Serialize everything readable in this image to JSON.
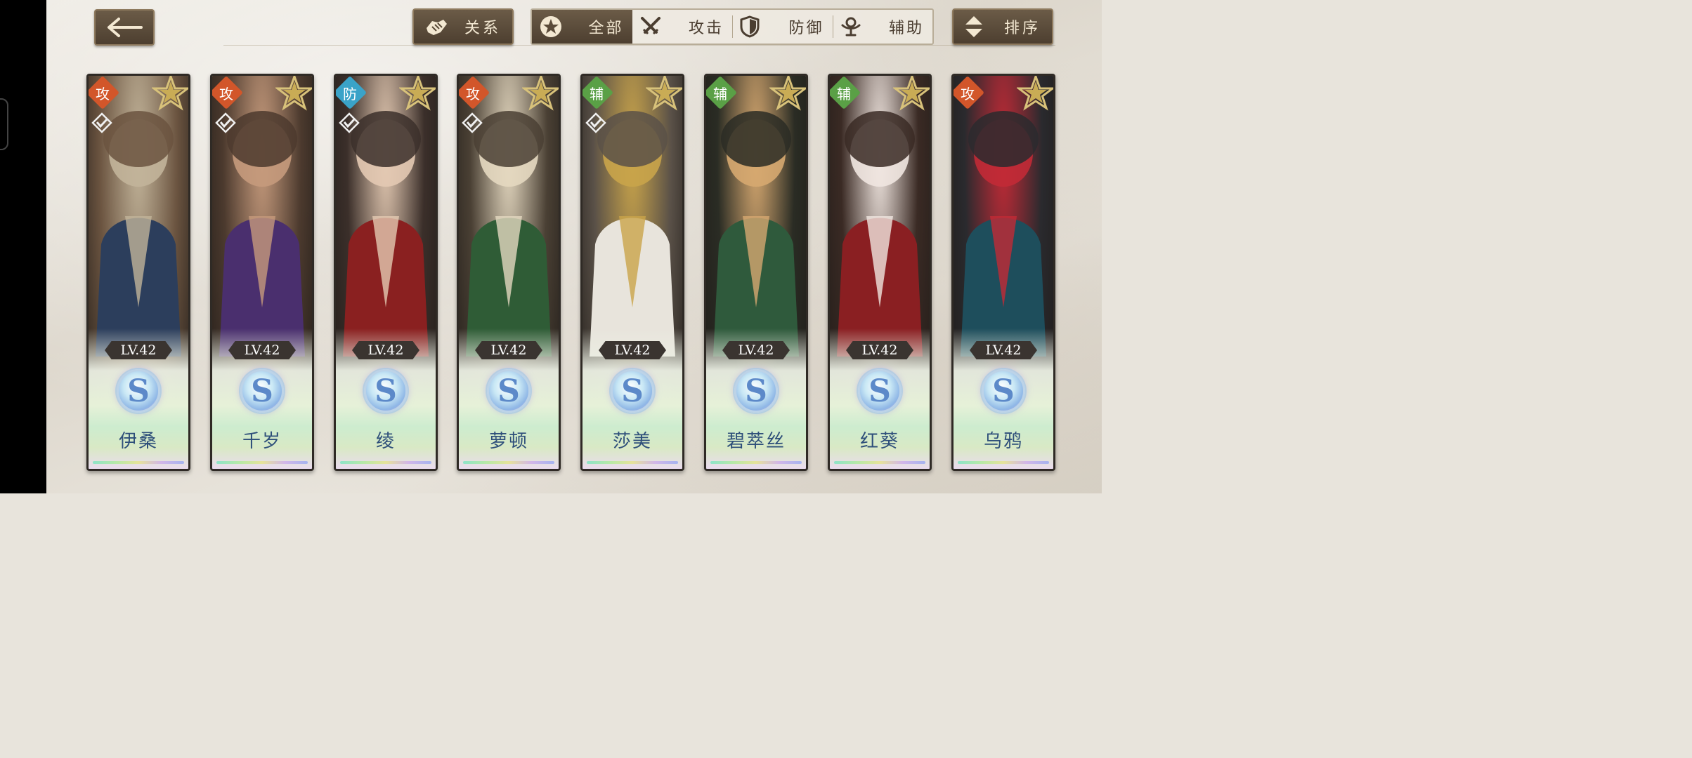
{
  "toolbar": {
    "back": "←",
    "relation_label": "关系",
    "sort_label": "排序"
  },
  "filters": [
    {
      "label": "全部",
      "icon": "star-circle-icon",
      "active": true
    },
    {
      "label": "攻击",
      "icon": "crossed-swords-icon",
      "active": false
    },
    {
      "label": "防御",
      "icon": "shield-icon",
      "active": false
    },
    {
      "label": "辅助",
      "icon": "support-icon",
      "active": false
    }
  ],
  "role_colors": {
    "攻": "#d2562a",
    "防": "#3aa3c8",
    "辅": "#5aa046"
  },
  "heroes": [
    {
      "name": "伊桑",
      "role": "攻",
      "level": "LV.42",
      "rank": "S",
      "selected": true,
      "palette": [
        "#6b5440",
        "#2c3e5c",
        "#c2b49a"
      ]
    },
    {
      "name": "千岁",
      "role": "攻",
      "level": "LV.42",
      "rank": "S",
      "selected": true,
      "palette": [
        "#4c3a2e",
        "#4a2f6e",
        "#c59a7c"
      ]
    },
    {
      "name": "绫",
      "role": "防",
      "level": "LV.42",
      "rank": "S",
      "selected": true,
      "palette": [
        "#3b2f2a",
        "#8a2020",
        "#e3c9b2"
      ]
    },
    {
      "name": "萝顿",
      "role": "攻",
      "level": "LV.42",
      "rank": "S",
      "selected": true,
      "palette": [
        "#4a4034",
        "#2f5c36",
        "#e4d8c0"
      ]
    },
    {
      "name": "莎美",
      "role": "辅",
      "level": "LV.42",
      "rank": "S",
      "selected": true,
      "palette": [
        "#5a5148",
        "#e8e4dc",
        "#c9a44a"
      ]
    },
    {
      "name": "碧萃丝",
      "role": "辅",
      "level": "LV.42",
      "rank": "S",
      "selected": false,
      "palette": [
        "#2a2c24",
        "#2f5a3c",
        "#d6a870"
      ]
    },
    {
      "name": "红葵",
      "role": "辅",
      "level": "LV.42",
      "rank": "S",
      "selected": false,
      "palette": [
        "#3a2a24",
        "#8a1f22",
        "#f0e6e0"
      ]
    },
    {
      "name": "乌鸦",
      "role": "攻",
      "level": "LV.42",
      "rank": "S",
      "selected": false,
      "palette": [
        "#2a2a2e",
        "#1e4e5c",
        "#c22a36"
      ]
    }
  ]
}
